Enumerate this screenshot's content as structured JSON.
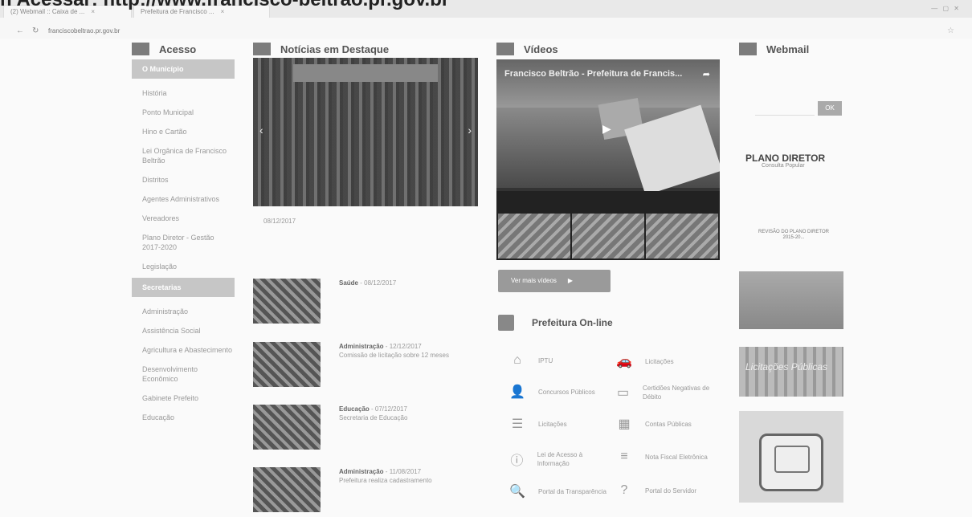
{
  "caption": "n Acessar: http://www.francisco-beltrao.pr.gov.br",
  "browser": {
    "tabs": [
      "(2) Webmail :: Caixa de ...",
      "Prefeitura de Francisco ..."
    ],
    "url": "franciscobeltrao.pr.gov.br",
    "back_icon": "arrow-left-icon",
    "reload_icon": "reload-icon",
    "star_icon": "star-icon"
  },
  "sections": {
    "acesso": "Acesso",
    "noticias": "Notícias em Destaque",
    "videos": "Vídeos",
    "webmail": "Webmail",
    "prefeitura": "Prefeitura On-line"
  },
  "sidebar": {
    "group1": "O Município",
    "items1": [
      "História",
      "Ponto Municipal",
      "Hino e Cartão",
      "Lei Orgânica de Francisco Beltrão",
      "Distritos",
      "Agentes Administrativos",
      "Vereadores",
      "Plano Diretor - Gestão 2017-2020",
      "Legislação"
    ],
    "group2": "Secretarias",
    "items2": [
      "Administração",
      "Assistência Social",
      "Agricultura e Abastecimento",
      "Desenvolvimento Econômico",
      "Gabinete Prefeito",
      "Educação"
    ]
  },
  "news": {
    "featured_date": "08/12/2017",
    "items": [
      {
        "tag": "Saúde",
        "date": "08/12/2017",
        "text": ""
      },
      {
        "tag": "Administração",
        "date": "12/12/2017",
        "text": "Comissão de licitação sobre 12 meses"
      },
      {
        "tag": "Educação",
        "date": "07/12/2017",
        "text": "Secretaria de Educação"
      },
      {
        "tag": "Administração",
        "date": "11/08/2017",
        "text": "Prefeitura realiza cadastramento"
      }
    ]
  },
  "video": {
    "title": "Francisco Beltrão - Prefeitura de Francis...",
    "more_button": "Ver mais vídeos"
  },
  "services": [
    {
      "icon": "house-icon",
      "label": "IPTU"
    },
    {
      "icon": "car-icon",
      "label": "Licitações"
    },
    {
      "icon": "person-icon",
      "label": "Concursos Públicos"
    },
    {
      "icon": "document-icon",
      "label": "Certidões Negativas de Débito"
    },
    {
      "icon": "list-icon",
      "label": "Licitações"
    },
    {
      "icon": "calculator-icon",
      "label": "Contas Públicas"
    },
    {
      "icon": "clock-icon",
      "label": "Lei de Acesso à Informação"
    },
    {
      "icon": "note-icon",
      "label": "Nota Fiscal Eletrônica"
    },
    {
      "icon": "search-icon",
      "label": "Portal da Transparência"
    },
    {
      "icon": "help-icon",
      "label": "Portal do Servidor"
    }
  ],
  "webmail": {
    "go_label": "OK"
  },
  "plano": {
    "title": "PLANO DIRETOR",
    "subtitle": "Consulta Popular",
    "info": "REVISÃO DO PLANO DIRETOR 2015-20..."
  },
  "banners": {
    "b2_text": "Licitações Públicas"
  }
}
